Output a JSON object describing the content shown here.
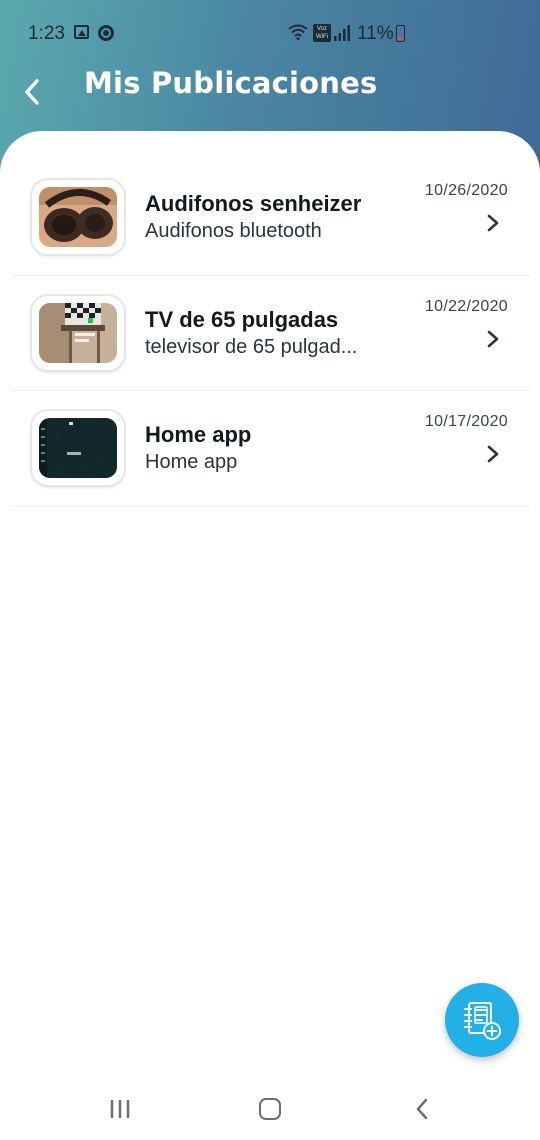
{
  "status_bar": {
    "time": "1:23",
    "network_badge": "Voz WiFi",
    "battery": "11%"
  },
  "header": {
    "title": "Mis Publicaciones",
    "back_icon": "chevron-left-icon"
  },
  "publications": [
    {
      "title": "Audifonos senheizer",
      "subtitle": "Audifonos bluetooth",
      "date": "10/26/2020"
    },
    {
      "title": "TV de 65 pulgadas",
      "subtitle": "televisor de 65 pulgad...",
      "date": "10/22/2020"
    },
    {
      "title": "Home app",
      "subtitle": "Home app",
      "date": "10/17/2020"
    }
  ],
  "fab": {
    "icon": "notebook-add-icon",
    "color": "#22b0e6"
  },
  "colors": {
    "header_gradient_start": "#5aa9ad",
    "header_gradient_end": "#3f6a96",
    "title_text": "#121a21"
  }
}
